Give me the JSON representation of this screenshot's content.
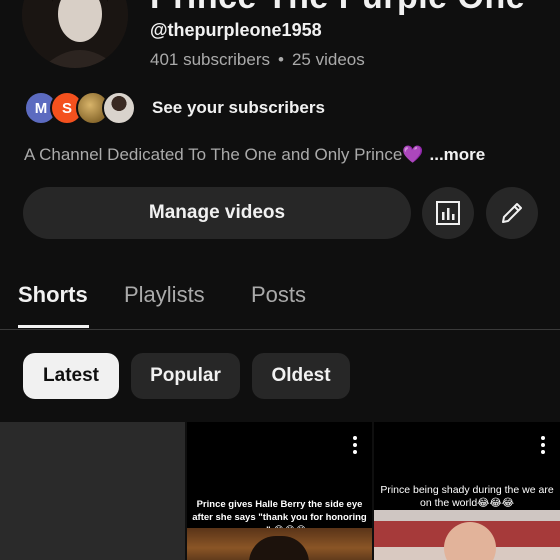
{
  "channel": {
    "name": "Prince The Purple One",
    "handle": "@thepurpleone1958",
    "subscribers": "401 subscribers",
    "videos": "25 videos",
    "separator": "•"
  },
  "subscribers_preview": {
    "avatars": [
      "M",
      "S",
      "",
      ""
    ],
    "label": "See your subscribers"
  },
  "description": {
    "text": "A Channel Dedicated To The One and Only Prince",
    "emoji": "💜",
    "more": "...more"
  },
  "actions": {
    "manage_videos": "Manage videos",
    "analytics_icon": "analytics-icon",
    "edit_icon": "pencil-icon"
  },
  "tabs": [
    {
      "label": "Shorts",
      "active": true
    },
    {
      "label": "Playlists",
      "active": false
    },
    {
      "label": "Posts",
      "active": false
    }
  ],
  "filters": [
    {
      "label": "Latest",
      "selected": true
    },
    {
      "label": "Popular",
      "selected": false
    },
    {
      "label": "Oldest",
      "selected": false
    }
  ],
  "shorts": [
    {
      "caption": ""
    },
    {
      "caption": "Prince gives Halle Berry the side eye after she says \"thank you for honoring me\" 😂😂😂"
    },
    {
      "caption": "Prince being shady during the we are on the world😂😂😂"
    }
  ]
}
